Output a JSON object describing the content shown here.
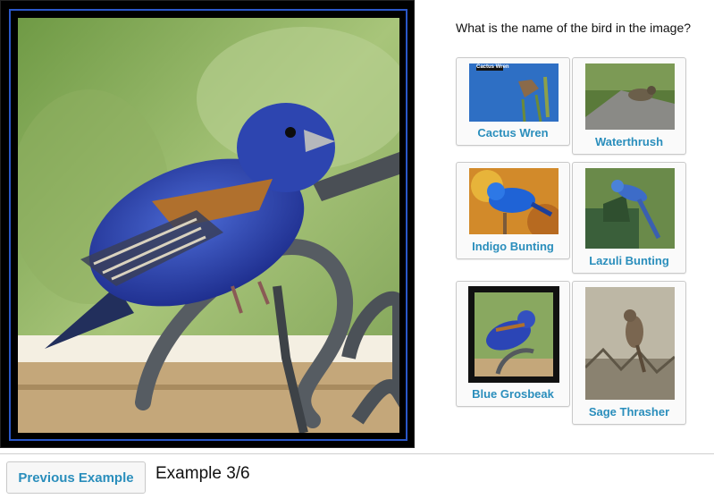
{
  "question": "What is the name of the bird in the image?",
  "options": [
    {
      "id": "cactus-wren",
      "label": "Cactus Wren",
      "thumb_title": "Cactus Wren"
    },
    {
      "id": "waterthrush",
      "label": "Waterthrush"
    },
    {
      "id": "indigo-bunting",
      "label": "Indigo Bunting"
    },
    {
      "id": "lazuli-bunting",
      "label": "Lazuli Bunting"
    },
    {
      "id": "blue-grosbeak",
      "label": "Blue Grosbeak",
      "selected": true
    },
    {
      "id": "sage-thrasher",
      "label": "Sage Thrasher"
    }
  ],
  "navigation": {
    "previous_label": "Previous Example",
    "counter": "Example 3/6"
  },
  "colors": {
    "label_link": "#2a8ebc",
    "frame_blue": "#2a57c9"
  }
}
